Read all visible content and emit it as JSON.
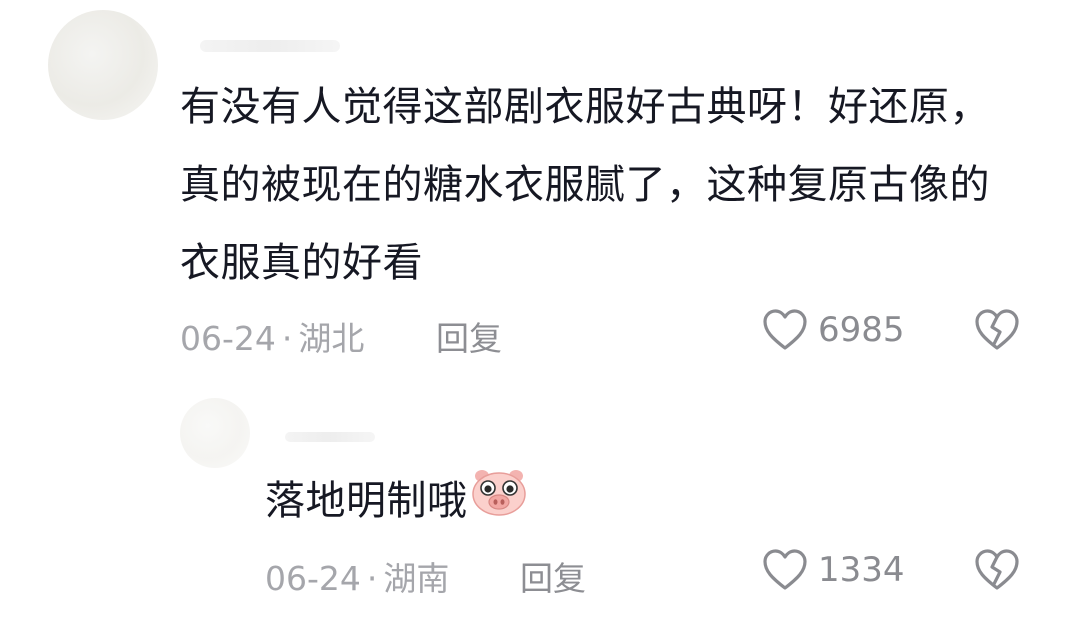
{
  "comments": [
    {
      "text": "有没有人觉得这部剧衣服好古典呀！好还原，真的被现在的糖水衣服腻了，这种复原古像的衣服真的好看",
      "date": "06-24",
      "location": "湖北",
      "reply_label": "回复",
      "like_count": "6985"
    },
    {
      "text": "落地明制哦",
      "emoji": "pig-emoji",
      "date": "06-24",
      "location": "湖南",
      "reply_label": "回复",
      "like_count": "1334"
    }
  ],
  "meta_separator": "·",
  "icons": {
    "like": "heart-outline-icon",
    "dislike": "broken-heart-icon"
  },
  "colors": {
    "text": "#161823",
    "meta": "#a5a6ab",
    "icon": "#8a8b90"
  }
}
